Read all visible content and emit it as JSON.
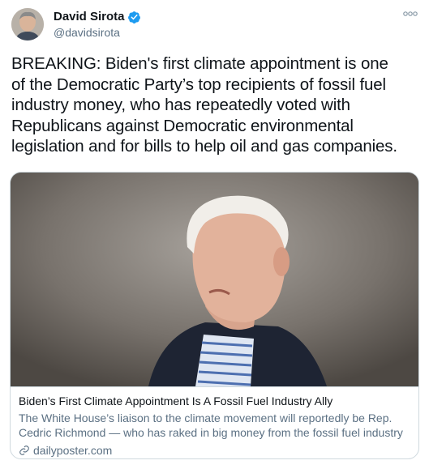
{
  "tweet": {
    "author": {
      "display_name": "David Sirota",
      "handle": "@davidsirota",
      "verified": true
    },
    "text": "BREAKING: Biden's first climate appointment is one\nof the Democratic Party’s top recipients of fossil fuel\nindustry money, who has repeatedly voted with\nRepublicans against Democratic environmental\nlegislation and for bills to help oil and gas companies.",
    "card": {
      "title": "Biden’s First Climate Appointment Is A Fossil Fuel Industry Ally",
      "description": "The White House’s liaison to the climate movement will reportedly be Rep. Cedric Richmond — who has raked in big money from the fossil fuel industry ...",
      "domain": "dailyposter.com"
    }
  },
  "colors": {
    "verified_blue": "#1d9bf0",
    "secondary_text": "#5b7083",
    "border": "#cfd9de"
  },
  "icons": {
    "verified": "verified-badge-icon",
    "more": "more-options-icon",
    "link": "link-icon"
  }
}
